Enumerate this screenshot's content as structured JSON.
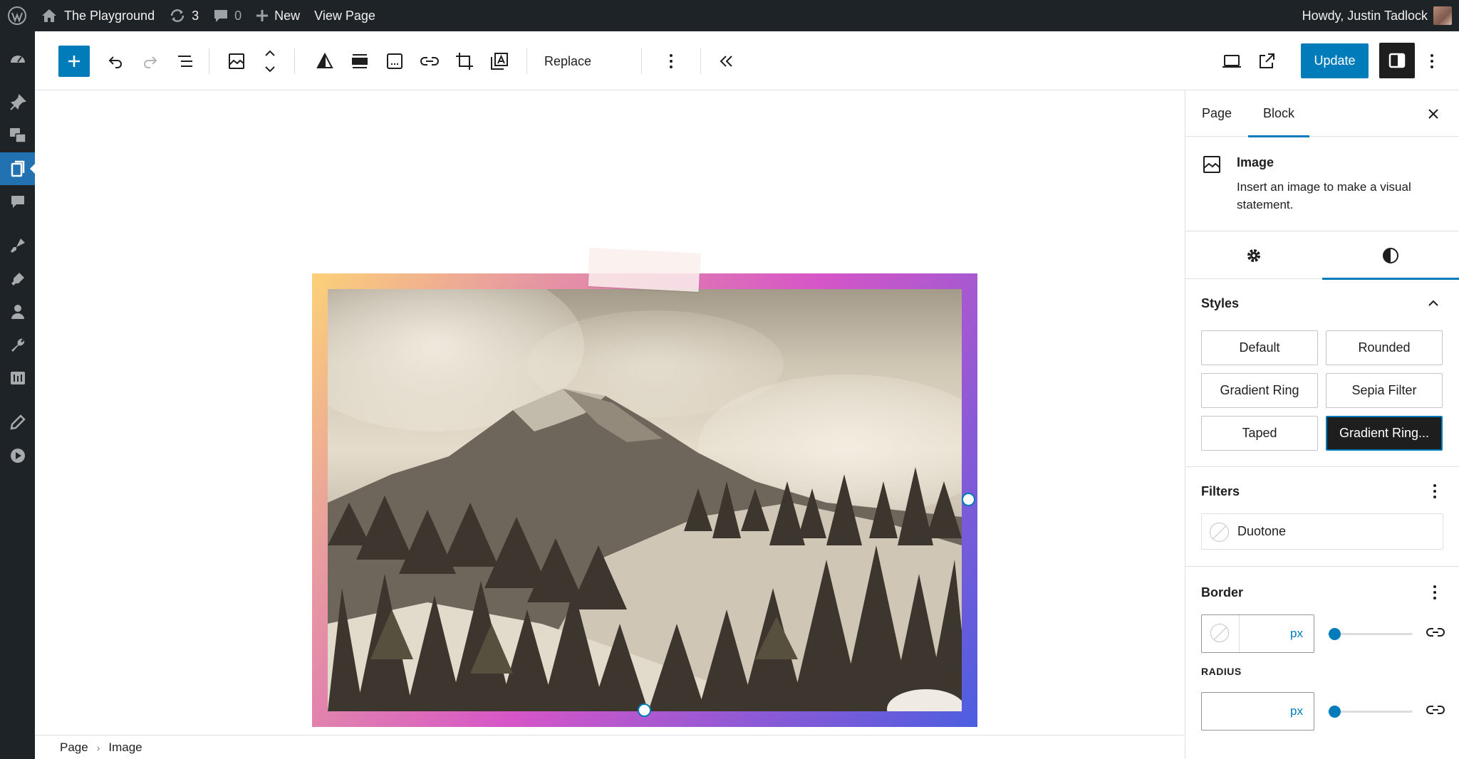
{
  "admin_bar": {
    "site_name": "The Playground",
    "updates_count": "3",
    "comments_count": "0",
    "new_label": "New",
    "view_page_label": "View Page",
    "greeting": "Howdy, Justin Tadlock"
  },
  "admin_menu": {
    "items": [
      "dashboard-icon",
      "posts-icon",
      "media-icon",
      "pages-icon",
      "comments-icon",
      "appearance-icon",
      "plugins-icon",
      "users-icon",
      "tools-icon",
      "settings-icon",
      "edit-icon",
      "video-icon"
    ],
    "active": "pages-icon"
  },
  "toolbar": {
    "replace_label": "Replace",
    "update_label": "Update"
  },
  "canvas": {
    "block_style": "Gradient Ring...",
    "ring_colors": [
      "#fcd178",
      "#e79aa0",
      "#d656c7",
      "#8a5ad6",
      "#4c5ee0"
    ],
    "image_subject": "sepia mountain landscape with snowy pine forest"
  },
  "breadcrumb": {
    "items": [
      "Page",
      "Image"
    ]
  },
  "sidebar": {
    "tabs": [
      "Page",
      "Block"
    ],
    "active_tab": "Block",
    "block": {
      "title": "Image",
      "description": "Insert an image to make a visual statement."
    },
    "styles": {
      "title": "Styles",
      "options": [
        "Default",
        "Rounded",
        "Gradient Ring",
        "Sepia Filter",
        "Taped",
        "Gradient Ring..."
      ],
      "selected": "Gradient Ring..."
    },
    "filters": {
      "title": "Filters",
      "duotone_label": "Duotone"
    },
    "border": {
      "title": "Border",
      "unit": "px",
      "radius_label": "RADIUS",
      "radius_unit": "px"
    }
  },
  "colors": {
    "accent": "#007cba",
    "admin_bg": "#1d2327",
    "dark_button": "#1e1e1e"
  }
}
